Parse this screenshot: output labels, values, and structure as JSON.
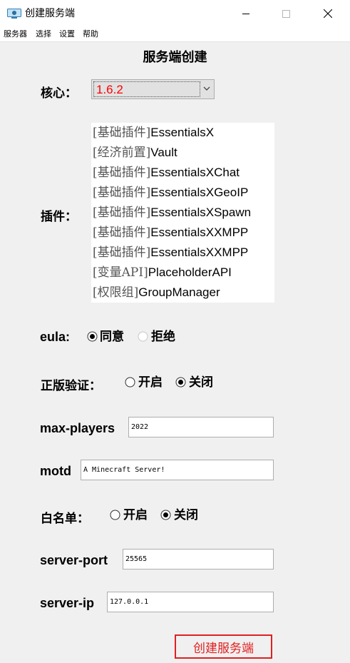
{
  "window": {
    "title": "创建服务端",
    "icon": "server-app-icon",
    "controls": [
      "minimize-icon",
      "maximize-icon",
      "close-icon"
    ]
  },
  "menu": [
    "服务器",
    "选择",
    "设置",
    "帮助"
  ],
  "heading": "服务端创建",
  "core": {
    "label": "核心：",
    "value": "1.6.2"
  },
  "plugins": {
    "label": "插件：",
    "items": [
      {
        "tag": "[基础插件]",
        "name": "EssentialsX"
      },
      {
        "tag": "[经济前置]",
        "name": "Vault"
      },
      {
        "tag": "[基础插件]",
        "name": "EssentialsXChat"
      },
      {
        "tag": "[基础插件]",
        "name": "EssentialsXGeoIP"
      },
      {
        "tag": "[基础插件]",
        "name": "EssentialsXSpawn"
      },
      {
        "tag": "[基础插件]",
        "name": "EssentialsXXMPP"
      },
      {
        "tag": "[基础插件]",
        "name": "EssentialsXXMPP"
      },
      {
        "tag": "[变量API]",
        "name": "PlaceholderAPI"
      },
      {
        "tag": "[权限组]",
        "name": "GroupManager"
      }
    ]
  },
  "eula": {
    "label": "eula:",
    "options": [
      "同意",
      "拒绝"
    ],
    "selected": "同意"
  },
  "online_mode": {
    "label": "正版验证：",
    "options": [
      "开启",
      "关闭"
    ],
    "selected": "关闭"
  },
  "max_players": {
    "label": "max-players",
    "value": "2022"
  },
  "motd": {
    "label": "motd",
    "value": "A Minecraft Server!"
  },
  "whitelist": {
    "label": "白名单：",
    "options": [
      "开启",
      "关闭"
    ],
    "selected": "关闭"
  },
  "server_port": {
    "label": "server-port",
    "value": "25565"
  },
  "server_ip": {
    "label": "server-ip",
    "value": "127.0.0.1"
  },
  "create_button": "创建服务端",
  "colors": {
    "accent_red": "#e02020",
    "select_value": "#ff0000"
  }
}
